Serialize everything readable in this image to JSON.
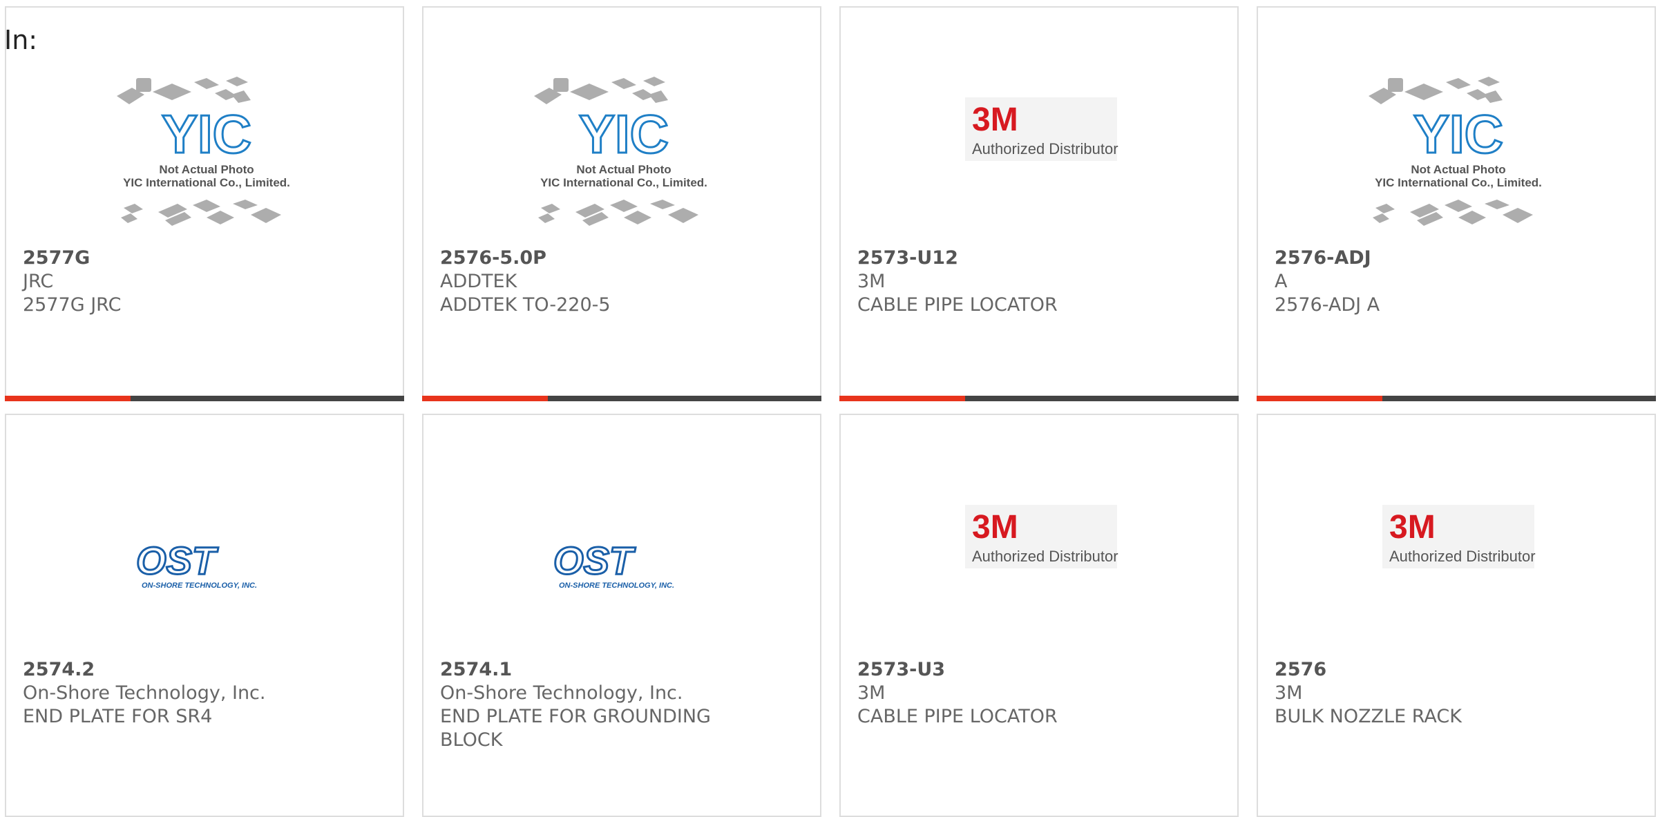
{
  "filter_label": "In:",
  "products": [
    {
      "part_number": "2577G",
      "manufacturer": "JRC",
      "description": "2577G JRC",
      "image": "yic-not-actual-photo"
    },
    {
      "part_number": "2576-5.0P",
      "manufacturer": "ADDTEK",
      "description": "ADDTEK TO-220-5",
      "image": "yic-not-actual-photo"
    },
    {
      "part_number": "2573-U12",
      "manufacturer": "3M",
      "description": "CABLE PIPE LOCATOR",
      "image": "3m-authorized-distributor"
    },
    {
      "part_number": "2576-ADJ",
      "manufacturer": "A",
      "description": "2576-ADJ A",
      "image": "yic-not-actual-photo"
    },
    {
      "part_number": "2574.2",
      "manufacturer": "On-Shore Technology, Inc.",
      "description": "END PLATE FOR SR4",
      "image": "ost-logo"
    },
    {
      "part_number": "2574.1",
      "manufacturer": "On-Shore Technology, Inc.",
      "description": "END PLATE FOR GROUNDING BLOCK",
      "image": "ost-logo"
    },
    {
      "part_number": "2573-U3",
      "manufacturer": "3M",
      "description": "CABLE PIPE LOCATOR",
      "image": "3m-authorized-distributor"
    },
    {
      "part_number": "2576",
      "manufacturer": "3M",
      "description": "BULK NOZZLE RACK",
      "image": "3m-authorized-distributor"
    }
  ],
  "logos": {
    "yic": {
      "mark": "YIC",
      "line1": "Not Actual Photo",
      "line2": "YIC International Co., Limited."
    },
    "threem": {
      "mark": "3M",
      "tagline": "Authorized Distributor"
    },
    "ost": {
      "mark": "OST",
      "tagline": "ON-SHORE TECHNOLOGY, INC."
    }
  },
  "colors": {
    "accent": "#e8341c",
    "bar": "#444444",
    "threem_red": "#d71920",
    "ost_blue": "#1a5fa8",
    "yic_blue": "#1f7fc6"
  }
}
